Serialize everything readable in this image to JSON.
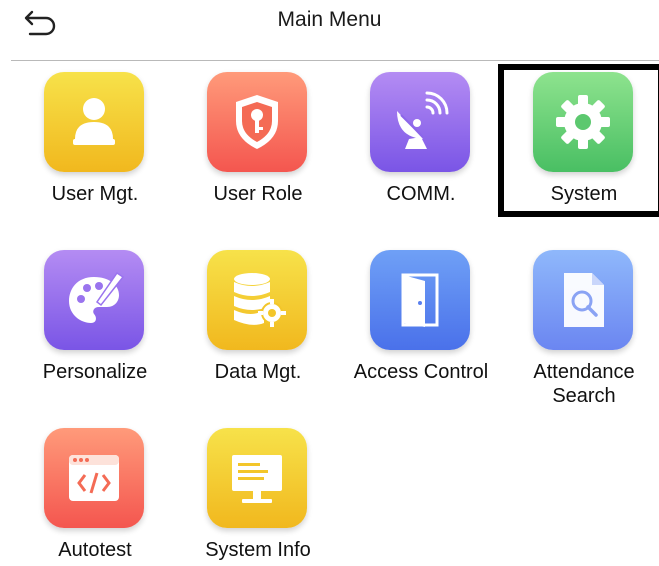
{
  "header": {
    "title": "Main Menu",
    "back_icon": "back-arrow-icon"
  },
  "menu": {
    "items": [
      {
        "label": "User Mgt.",
        "icon": "user-icon",
        "color_top": "#f7e24a",
        "color_bottom": "#f1b81e"
      },
      {
        "label": "User Role",
        "icon": "shield-key-icon",
        "color_top": "#ff9a7a",
        "color_bottom": "#f4564f"
      },
      {
        "label": "COMM.",
        "icon": "satellite-dish-icon",
        "color_top": "#b48cf3",
        "color_bottom": "#7a55e6"
      },
      {
        "label": "System",
        "icon": "gear-icon",
        "color_top": "#8ee38e",
        "color_bottom": "#49bf63",
        "selected": true
      },
      {
        "label": "Personalize",
        "icon": "palette-icon",
        "color_top": "#b48cf3",
        "color_bottom": "#7a55e6"
      },
      {
        "label": "Data Mgt.",
        "icon": "database-gear-icon",
        "color_top": "#f7e24a",
        "color_bottom": "#f1b81e"
      },
      {
        "label": "Access Control",
        "icon": "door-icon",
        "color_top": "#6fa0f6",
        "color_bottom": "#4a71ea"
      },
      {
        "label": "Attendance\nSearch",
        "icon": "document-search-icon",
        "color_top": "#8fb8fb",
        "color_bottom": "#6b86f1"
      },
      {
        "label": "Autotest",
        "icon": "code-window-icon",
        "color_top": "#ff9a7a",
        "color_bottom": "#f4564f"
      },
      {
        "label": "System Info",
        "icon": "monitor-icon",
        "color_top": "#f7e24a",
        "color_bottom": "#f1b81e"
      }
    ]
  }
}
